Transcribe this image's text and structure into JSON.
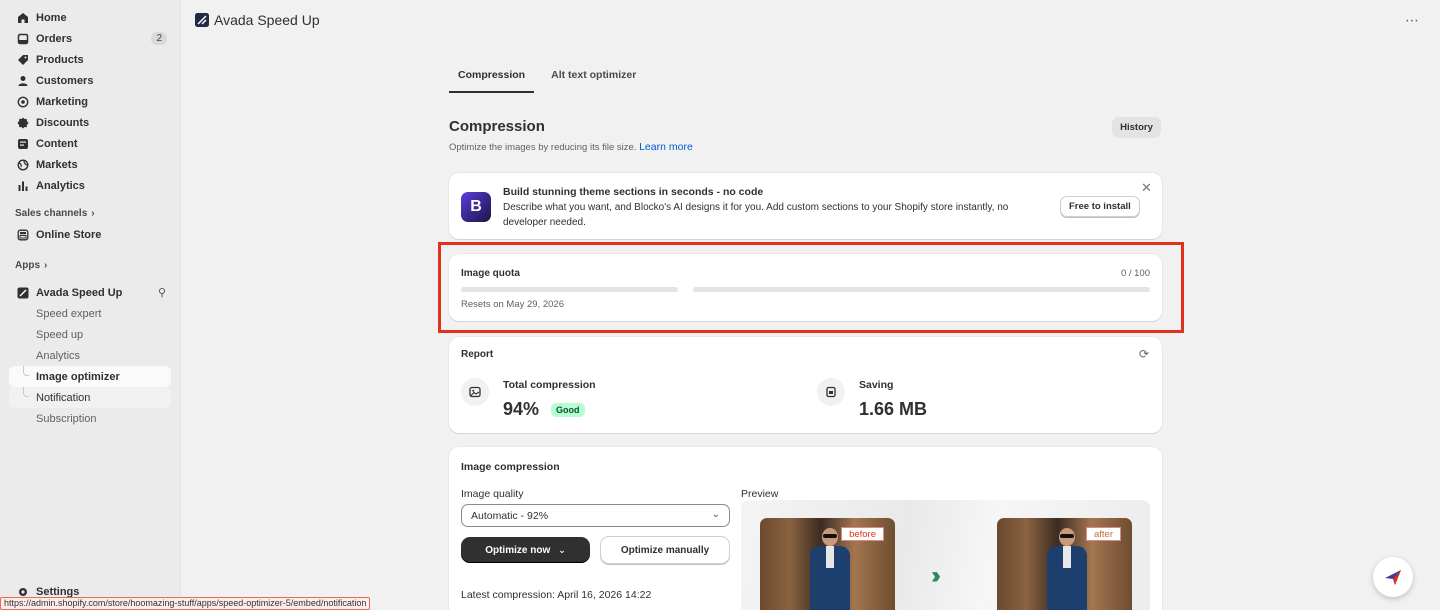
{
  "sidebar": {
    "items": [
      {
        "label": "Home",
        "icon": "home-icon"
      },
      {
        "label": "Orders",
        "icon": "orders-icon",
        "badge": "2"
      },
      {
        "label": "Products",
        "icon": "tag-icon"
      },
      {
        "label": "Customers",
        "icon": "person-icon"
      },
      {
        "label": "Marketing",
        "icon": "target-icon"
      },
      {
        "label": "Discounts",
        "icon": "discount-icon"
      },
      {
        "label": "Content",
        "icon": "content-icon"
      },
      {
        "label": "Markets",
        "icon": "globe-icon"
      },
      {
        "label": "Analytics",
        "icon": "bar-chart-icon"
      }
    ],
    "sales_channels_label": "Sales channels",
    "online_store_label": "Online Store",
    "apps_label": "Apps",
    "app_name": "Avada Speed Up",
    "app_sub_items": [
      "Speed expert",
      "Speed up",
      "Analytics",
      "Image optimizer",
      "Notification",
      "Subscription"
    ],
    "settings_label": "Settings"
  },
  "header": {
    "title": "Avada Speed Up",
    "more": "⋯"
  },
  "tabs": [
    {
      "label": "Compression",
      "active": true
    },
    {
      "label": "Alt text optimizer",
      "active": false
    }
  ],
  "page": {
    "title": "Compression",
    "subtitle": "Optimize the images by reducing its file size.",
    "learn_more": "Learn more",
    "history_button": "History"
  },
  "promo": {
    "title": "Build stunning theme sections in seconds - no code",
    "description": "Describe what you want, and Blocko's AI designs it for you. Add custom sections to your Shopify store instantly, no developer needed.",
    "button": "Free to install"
  },
  "quota": {
    "title": "Image quota",
    "count": "0 / 100",
    "used_fraction": 0,
    "reset_text": "Resets on May 29, 2026"
  },
  "report": {
    "title": "Report",
    "total_compression_label": "Total compression",
    "total_compression_value": "94%",
    "badge": "Good",
    "saving_label": "Saving",
    "saving_value": "1.66 MB"
  },
  "image_compression": {
    "title": "Image compression",
    "quality_label": "Image quality",
    "quality_value": "Automatic - 92%",
    "optimize_now": "Optimize now",
    "optimize_manually": "Optimize manually",
    "latest": "Latest compression: April 16, 2026 14:22",
    "preview_label": "Preview",
    "before_tag": "before",
    "after_tag": "after"
  },
  "status_url": "https://admin.shopify.com/store/hoomazing-stuff/apps/speed-optimizer-5/embed/notification",
  "colors": {
    "accent_link": "#005bd3",
    "highlight_border": "#e0301e",
    "good_badge_bg": "#b4fed2",
    "primary_button": "#303030"
  }
}
